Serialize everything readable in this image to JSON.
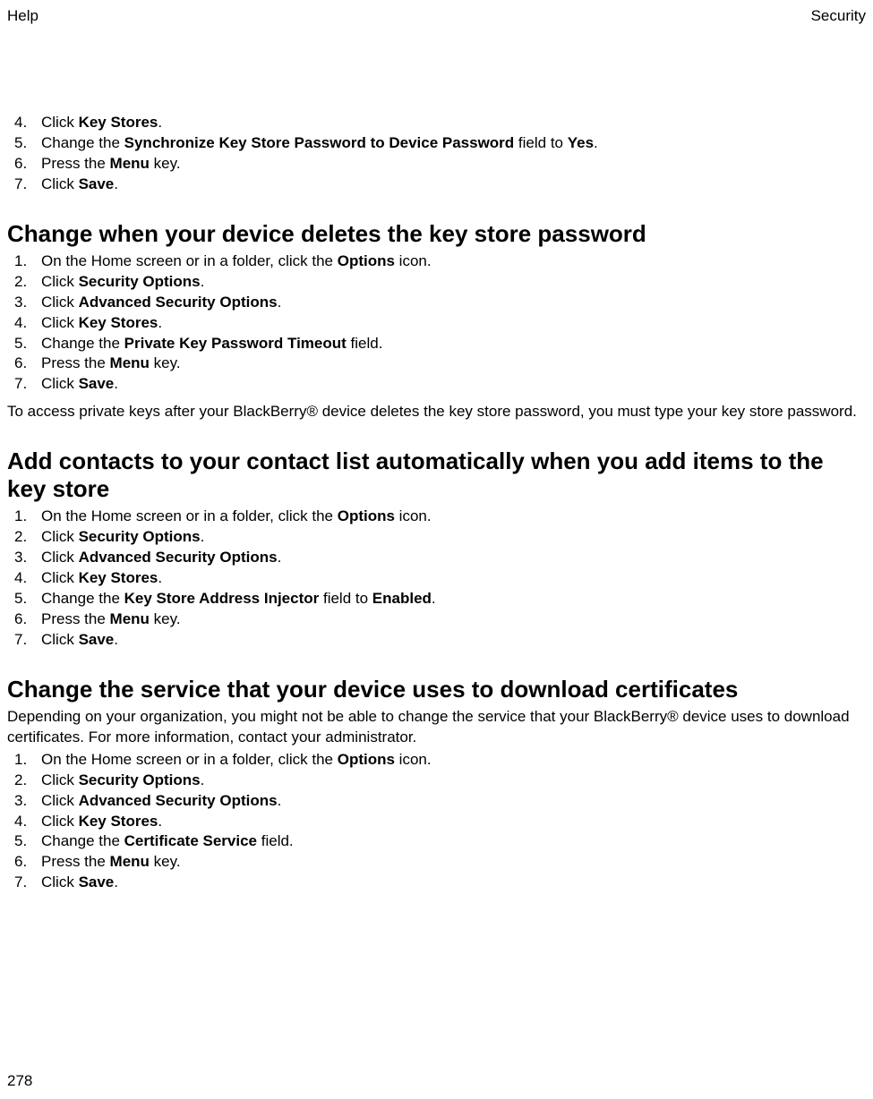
{
  "header": {
    "left": "Help",
    "right": "Security"
  },
  "page_number": "278",
  "sections": {
    "top_steps": {
      "s4": {
        "pre": "Click ",
        "bold": "Key Stores",
        "post": "."
      },
      "s5": {
        "pre": "Change the ",
        "bold": "Synchronize Key Store Password to Device Password",
        "mid": " field to ",
        "bold2": "Yes",
        "post": "."
      },
      "s6": {
        "pre": "Press the ",
        "bold": "Menu",
        "post": " key."
      },
      "s7": {
        "pre": "Click ",
        "bold": "Save",
        "post": "."
      }
    },
    "change_when_deletes": {
      "title": "Change when your device deletes the key store password",
      "s1": {
        "pre": "On the Home screen or in a folder, click the ",
        "bold": "Options",
        "post": " icon."
      },
      "s2": {
        "pre": "Click ",
        "bold": "Security Options",
        "post": "."
      },
      "s3": {
        "pre": "Click ",
        "bold": "Advanced Security Options",
        "post": "."
      },
      "s4": {
        "pre": "Click ",
        "bold": "Key Stores",
        "post": "."
      },
      "s5": {
        "pre": "Change the ",
        "bold": "Private Key Password Timeout",
        "post": " field."
      },
      "s6": {
        "pre": "Press the ",
        "bold": "Menu",
        "post": " key."
      },
      "s7": {
        "pre": "Click ",
        "bold": "Save",
        "post": "."
      },
      "note": "To access private keys after your BlackBerry® device deletes the key store password, you must type your key store password."
    },
    "add_contacts": {
      "title": "Add contacts to your contact list automatically when you add items to the key store",
      "s1": {
        "pre": "On the Home screen or in a folder, click the ",
        "bold": "Options",
        "post": " icon."
      },
      "s2": {
        "pre": "Click ",
        "bold": "Security Options",
        "post": "."
      },
      "s3": {
        "pre": "Click ",
        "bold": "Advanced Security Options",
        "post": "."
      },
      "s4": {
        "pre": "Click ",
        "bold": "Key Stores",
        "post": "."
      },
      "s5": {
        "pre": "Change the ",
        "bold": "Key Store Address Injector",
        "mid": " field to ",
        "bold2": "Enabled",
        "post": "."
      },
      "s6": {
        "pre": "Press the ",
        "bold": "Menu",
        "post": " key."
      },
      "s7": {
        "pre": "Click ",
        "bold": "Save",
        "post": "."
      }
    },
    "change_service": {
      "title": "Change the service that your device uses to download certificates",
      "intro": "Depending on your organization, you might not be able to change the service that your BlackBerry® device uses to download certificates. For more information, contact your administrator.",
      "s1": {
        "pre": "On the Home screen or in a folder, click the ",
        "bold": "Options",
        "post": " icon."
      },
      "s2": {
        "pre": "Click ",
        "bold": "Security Options",
        "post": "."
      },
      "s3": {
        "pre": "Click ",
        "bold": "Advanced Security Options",
        "post": "."
      },
      "s4": {
        "pre": "Click ",
        "bold": "Key Stores",
        "post": "."
      },
      "s5": {
        "pre": "Change the ",
        "bold": "Certificate Service",
        "post": " field."
      },
      "s6": {
        "pre": "Press the ",
        "bold": "Menu",
        "post": " key."
      },
      "s7": {
        "pre": "Click ",
        "bold": "Save",
        "post": "."
      }
    }
  }
}
